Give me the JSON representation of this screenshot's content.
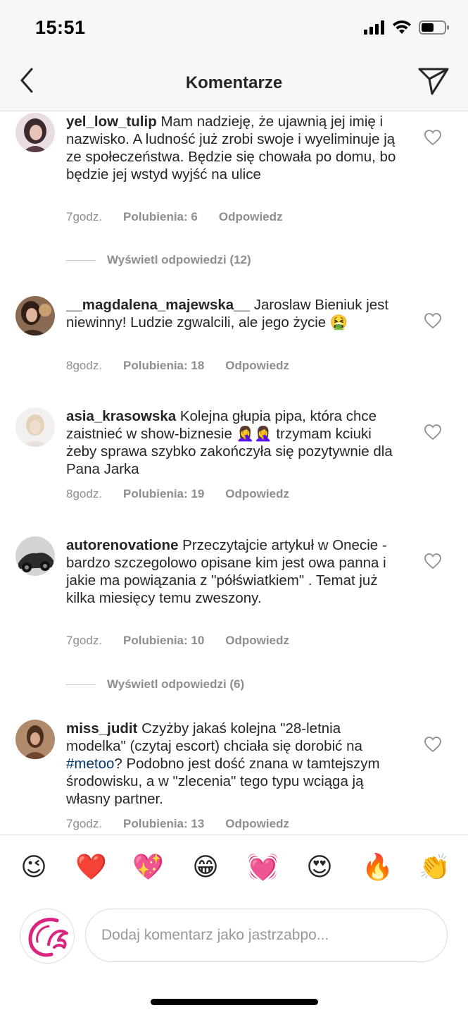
{
  "status_bar": {
    "time": "15:51"
  },
  "header": {
    "title": "Komentarze"
  },
  "comments": [
    {
      "username": "yel_low_tulip",
      "text": "Mam nadzieję, że ujawnią jej imię i nazwisko. A ludność już zrobi swoje i wyeliminuje ją ze społeczeństwa. Będzie się chowała po domu, bo będzie jej wstyd wyjść na ulice",
      "time": "7godz.",
      "likes": "Polubienia: 6",
      "reply": "Odpowiedz"
    },
    {
      "username": "__magdalena_majewska__",
      "text": "Jaroslaw Bieniuk jest niewinny! Ludzie zgwalcili, ale jego życie",
      "emoji": "🤮",
      "time": "8godz.",
      "likes": "Polubienia: 18",
      "reply": "Odpowiedz"
    },
    {
      "username": "asia_krasowska",
      "text_before": "Kolejna głupia pipa, która chce zaistnieć w show-biznesie",
      "emoji": "🤦‍♀️🤦‍♀️",
      "text_after": "trzymam kciuki żeby sprawa szybko zakończyła się pozytywnie dla Pana Jarka",
      "time": "8godz.",
      "likes": "Polubienia: 19",
      "reply": "Odpowiedz"
    },
    {
      "username": "autorenovatione",
      "text": "Przeczytajcie artykuł w Onecie - bardzo szczegolowo opisane kim jest owa panna i jakie ma powiązania z \"półświatkiem\" . Temat już kilka miesięcy temu zweszony.",
      "time": "7godz.",
      "likes": "Polubienia: 10",
      "reply": "Odpowiedz"
    },
    {
      "username": "miss_judit",
      "text_before": "Czyżby jakaś kolejna \"28-letnia modelka\" (czytaj escort) chciała się dorobić na",
      "hashtag": "#metoo",
      "text_after": "? Podobno jest dość znana w tamtejszym środowisku, a w \"zlecenia\" tego typu wciąga ją własny partner.",
      "time": "7godz.",
      "likes": "Polubienia: 13",
      "reply": "Odpowiedz"
    }
  ],
  "view_replies": [
    {
      "label": "Wyświetl odpowiedzi (12)"
    },
    {
      "label": "Wyświetl odpowiedzi (6)"
    }
  ],
  "emoji_bar": [
    {
      "name": "winking-face",
      "char": "😉"
    },
    {
      "name": "red-heart",
      "char": "❤️"
    },
    {
      "name": "sparkling-heart",
      "char": "💖"
    },
    {
      "name": "grinning-face",
      "char": "😁"
    },
    {
      "name": "heartbeat",
      "char": "💓"
    },
    {
      "name": "heart-eyes",
      "char": "😍"
    },
    {
      "name": "fire",
      "char": "🔥"
    },
    {
      "name": "clapping-hands",
      "char": "👏"
    }
  ],
  "input": {
    "placeholder": "Dodaj komentarz jako jastrzabpo..."
  },
  "colors": {
    "text": "#262626",
    "meta": "#8e8e8e",
    "hashtag": "#003569",
    "divider": "#dbdbdb",
    "bar_background": "#f7f7f7",
    "brand_logo": "#d8257f"
  }
}
